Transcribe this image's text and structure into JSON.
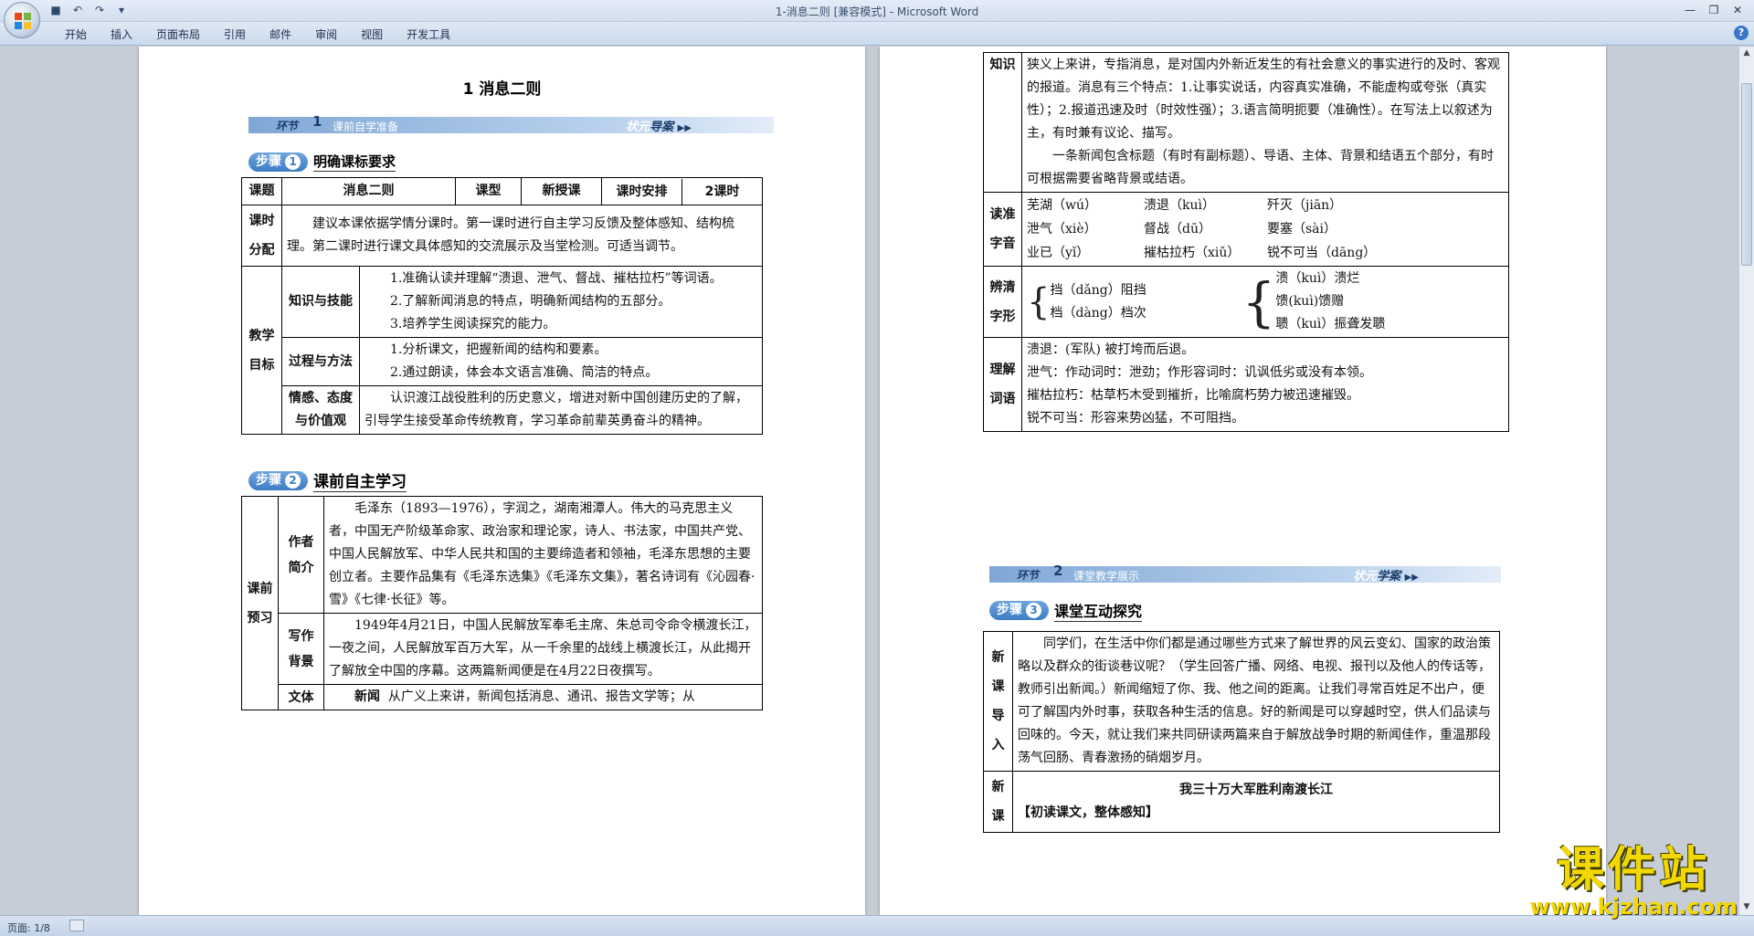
{
  "window": {
    "title": "1-消息二则 [兼容模式] - Microsoft Word",
    "quick_access": [
      "save-icon",
      "undo-icon",
      "redo-icon",
      "customize-icon"
    ]
  },
  "ribbon": {
    "tabs": [
      "开始",
      "插入",
      "页面布局",
      "引用",
      "邮件",
      "审阅",
      "视图",
      "开发工具"
    ]
  },
  "status": {
    "page": "页面: 1/8"
  },
  "page1": {
    "heading": "1  消息二则",
    "banner": {
      "label": "环节",
      "num": "1",
      "sub": "课前自学准备",
      "right_a": "状元",
      "right_b": "导案"
    },
    "step1": {
      "num": "1",
      "pill": "步骤",
      "title": "明确课标要求"
    },
    "info_row": [
      "课题",
      "消息二则",
      "课型",
      "新授课",
      "课时安排",
      "2课时"
    ],
    "allocation": {
      "label": "课时分配",
      "text": "建议本课依据学情分课时。第一课时进行自主学习反馈及整体感知、结构梳理。第二课时进行课文具体感知的交流展示及当堂检测。可适当调节。"
    },
    "goals": {
      "label": "教学目标",
      "rows": [
        {
          "name": "知识与技能",
          "lines": [
            "1.准确认读并理解“溃退、泄气、督战、摧枯拉朽”等词语。",
            "2.了解新闻消息的特点，明确新闻结构的五部分。",
            "3.培养学生阅读探究的能力。"
          ]
        },
        {
          "name": "过程与方法",
          "lines": [
            "1.分析课文，把握新闻的结构和要素。",
            "2.通过朗读，体会本文语言准确、简洁的特点。"
          ]
        },
        {
          "name": "情感、态度与价值观",
          "lines": [
            "认识渡江战役胜利的历史意义，增进对新中国创建历史的了解，引导学生接受革命传统教育，学习革命前辈英勇奋斗的精神。"
          ]
        }
      ]
    },
    "step2": {
      "num": "2",
      "pill": "步骤",
      "title": "课前自主学习"
    },
    "preview": {
      "label": "课前预习",
      "author": {
        "name": "作者简介",
        "text": "毛泽东（1893—1976），字润之，湖南湘潭人。伟大的马克思主义者，中国无产阶级革命家、政治家和理论家，诗人、书法家，中国共产党、中国人民解放军、中华人民共和国的主要缔造者和领袖，毛泽东思想的主要创立者。主要作品集有《毛泽东选集》《毛泽东文集》，著名诗词有《沁园春·雪》《七律·长征》等。"
      },
      "background": {
        "name": "写作背景",
        "text": "1949年4月21日，中国人民解放军奉毛主席、朱总司令命令横渡长江，一夜之间，人民解放军百万大军，从一千余里的战线上横渡长江，从此揭开了解放全中国的序幕。这两篇新闻便是在4月22日夜撰写。"
      },
      "genre": {
        "name": "文体",
        "term": "新闻",
        "text": "从广义上来讲，新闻包括消息、通讯、报告文学等；从"
      }
    }
  },
  "page2": {
    "knowledge": {
      "label": "知识",
      "p1": "狭义上来讲，专指消息，是对国内外新近发生的有社会意义的事实进行的及时、客观的报道。消息有三个特点：1.让事实说话，内容真实准确，不能虚构或夸张（真实性）；2.报道迅速及时（时效性强）；3.语言简明扼要（准确性）。在写法上以叙述为主，有时兼有议论、描写。",
      "p2": "一条新闻包含标题（有时有副标题）、导语、主体、背景和结语五个部分，有时可根据需要省略背景或结语。"
    },
    "pronounce": {
      "label": "读准字音",
      "items": [
        "芜湖（wú）",
        "溃退（kuì）",
        "歼灭（jiān）",
        "泄气（xiè）",
        "督战（dū）",
        "要塞（sài）",
        "业已（yǐ）",
        "摧枯拉朽（xiǔ）",
        "锐不可当（dāng）"
      ]
    },
    "distinguish": {
      "label": "辨清字形",
      "left": [
        "挡（dǎng）阻挡",
        "档（dàng）档次"
      ],
      "right": [
        "溃（kuì）溃烂",
        "馈(kuì)馈赠",
        "聩（kuì）振聋发聩"
      ]
    },
    "understand": {
      "label": "理解词语",
      "lines": [
        "溃退：(军队) 被打垮而后退。",
        "泄气：作动词时：泄劲；作形容词时：讥讽低劣或没有本领。",
        "摧枯拉朽：枯草朽木受到摧折，比喻腐朽势力被迅速摧毁。",
        "锐不可当：形容来势凶猛，不可阻挡。"
      ]
    },
    "banner": {
      "label": "环节",
      "num": "2",
      "sub": "课堂教学展示",
      "right_a": "状元",
      "right_b": "学案"
    },
    "step3": {
      "num": "3",
      "pill": "步骤",
      "title": "课堂互动探究"
    },
    "intro": {
      "label": "新课导入",
      "text": "同学们，在生活中你们都是通过哪些方式来了解世界的风云变幻、国家的政治策略以及群众的街谈巷议呢？（学生回答广播、网络、电视、报刊以及他人的传话等，教师引出新闻。）新闻缩短了你、我、他之间的距离。让我们寻常百姓足不出户，便可了解国内外时事，获取各种生活的信息。好的新闻是可以穿越时空，供人们品读与回味的。今天，就让我们来共同研读两篇来自于解放战争时期的新闻佳作，重温那段荡气回肠、青春激扬的硝烟岁月。"
    },
    "newlesson": {
      "label": "新课",
      "title": "我三十万大军胜利南渡长江",
      "sub": "【初读课文，整体感知】"
    }
  },
  "watermark": {
    "text": "课件站",
    "url": "www.kjzhan.com"
  }
}
